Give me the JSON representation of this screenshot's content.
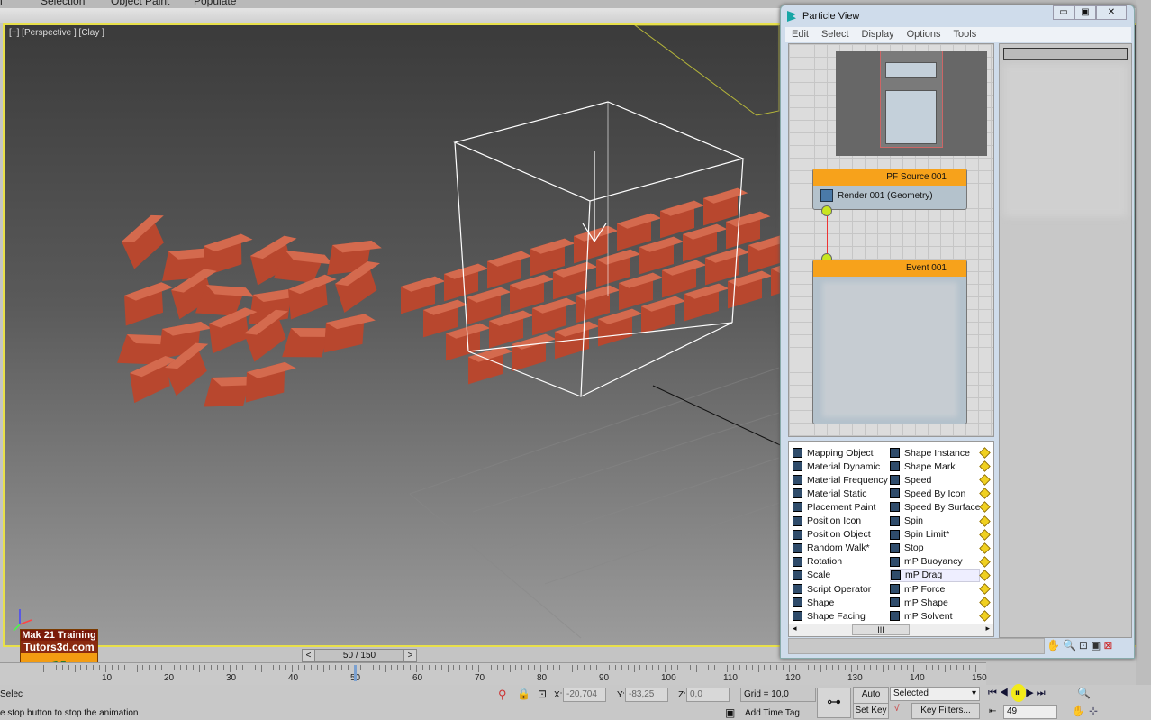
{
  "top_menu": [
    "n",
    "Selection",
    "Object Paint",
    "Populate"
  ],
  "viewport": {
    "label": "[+] [Perspective ] [Clay ]"
  },
  "logo": {
    "line1": "Mak 21 Training",
    "line2": "Tutors3d.com"
  },
  "time_slider": {
    "value": "50 / 150",
    "prev": "<",
    "next": ">",
    "current_frame": 50,
    "total_frames": 150
  },
  "track_labels": [
    "10",
    "20",
    "30",
    "40",
    "50",
    "60",
    "70",
    "80",
    "90",
    "100",
    "110",
    "120",
    "130",
    "140",
    "150"
  ],
  "status": {
    "selection": "Selec",
    "prompt": "e stop button to stop the animation",
    "x_label": "X:",
    "x": "-20,704",
    "y_label": "Y:",
    "y": "-83,25",
    "z_label": "Z:",
    "z": "0,0",
    "grid": "Grid = 10,0",
    "add_time_tag": "Add Time Tag",
    "auto_key": "Auto Key",
    "set_key": "Set Key",
    "key_mode": "Selected",
    "key_filters": "Key Filters...",
    "frame": "49"
  },
  "particle_view": {
    "title": "Particle View",
    "menu": [
      "Edit",
      "Select",
      "Display",
      "Options",
      "Tools"
    ],
    "source_node": {
      "title": "PF Source 001",
      "operator": "Render 001 (Geometry)"
    },
    "event_node": {
      "title": "Event 001"
    },
    "depot_col1": [
      "Mapping Object",
      "Material Dynamic",
      "Material Frequency",
      "Material Static",
      "Placement Paint",
      "Position Icon",
      "Position Object",
      "Random Walk*",
      "Rotation",
      "Scale",
      "Script Operator",
      "Shape",
      "Shape Facing"
    ],
    "depot_col2": [
      "Shape Instance",
      "Shape Mark",
      "Speed",
      "Speed By Icon",
      "Speed By Surface",
      "Spin",
      "Spin Limit*",
      "Stop",
      "mP Buoyancy",
      "mP Drag",
      "mP Force",
      "mP Shape",
      "mP Solvent"
    ],
    "selected_item": "mP Drag",
    "scroll_thumb": "III"
  },
  "colors": {
    "viewport_border": "#e8e04a",
    "node_header": "#f7a21b",
    "wire_connector": "#c9e620"
  }
}
